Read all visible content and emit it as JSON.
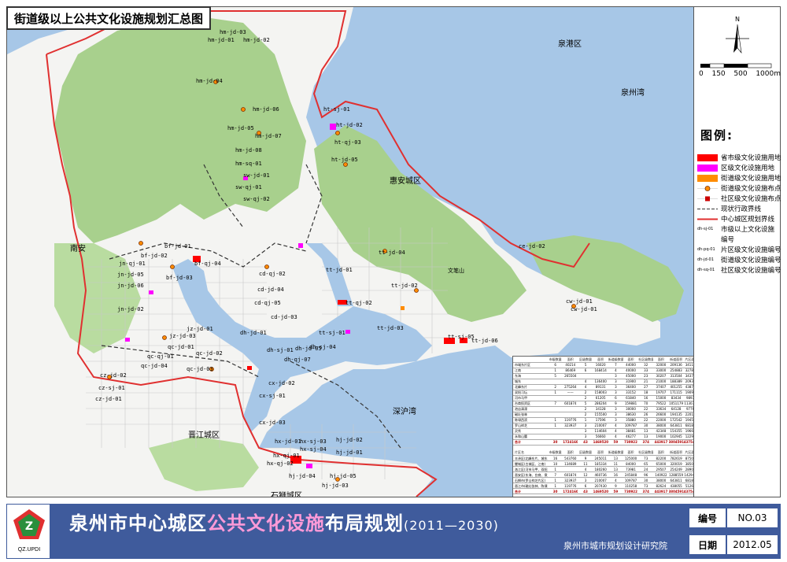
{
  "map_title": "街道级以上公共文化设施规划汇总图",
  "main_title_pre": "泉州市中心城区",
  "main_title_highlight": "公共文化设施",
  "main_title_post": "布局规划",
  "main_title_years": "(2011—2030)",
  "institute": "泉州市城市规划设计研究院",
  "logo_text": "QZ.UPDI",
  "info": {
    "number_label": "编号",
    "number_value": "NO.03",
    "date_label": "日期",
    "date_value": "2012.05"
  },
  "compass_letter": "N",
  "scale": {
    "labels": [
      "0",
      "150",
      "500",
      "1000m"
    ]
  },
  "legend": {
    "title": "图例:",
    "items": [
      {
        "label": "省市级文化设施用地",
        "color": "#ff0000",
        "kind": "fill"
      },
      {
        "label": "区级文化设施用地",
        "color": "#ff00ff",
        "kind": "fill"
      },
      {
        "label": "街道级文化设施用地",
        "color": "#ff8c00",
        "kind": "fill"
      },
      {
        "label": "街道级文化设施布点",
        "color": "#ff8c00",
        "kind": "point"
      },
      {
        "label": "社区级文化设施布点",
        "color": "#cc0000",
        "kind": "square"
      },
      {
        "label": "现状行政界线",
        "color": "#555555",
        "kind": "dash"
      },
      {
        "label": "中心城区规划界线",
        "color": "#e03030",
        "kind": "line"
      },
      {
        "label": "市级以上文化设施",
        "color": "#000000",
        "kind": "code",
        "code": "dh-sj-01"
      },
      {
        "label": "编号",
        "color": "#000000",
        "kind": "none"
      },
      {
        "label": "片区级文化设施编号",
        "color": "#000000",
        "kind": "code",
        "code": "dh-pq-01"
      },
      {
        "label": "街道级文化设施编号",
        "color": "#000000",
        "kind": "code",
        "code": "dh-jd-01"
      },
      {
        "label": "社区级文化设施编号",
        "color": "#000000",
        "kind": "code",
        "code": "dh-sq-01"
      }
    ]
  },
  "place_labels": [
    {
      "text": "泉港区"
    },
    {
      "text": "泉州湾"
    },
    {
      "text": "惠安城区"
    },
    {
      "text": "南安"
    },
    {
      "text": "晋江城区"
    },
    {
      "text": "石狮城区"
    },
    {
      "text": "深沪湾"
    },
    {
      "text": "文笔山"
    }
  ],
  "facility_codes": [
    "hm-jd-03",
    "hm-jd-01",
    "hm-jd-02",
    "hm-jd-04",
    "hm-jd-06",
    "hm-jd-05",
    "hm-jd-07",
    "hm-jd-08",
    "hm-sq-01",
    "sw-jd-01",
    "sw-qj-01",
    "sw-qj-02",
    "ht-sj-01",
    "ht-jd-02",
    "ht-qj-03",
    "ht-jd-05",
    "bf-jd-01",
    "bf-jd-02",
    "bf-qj-04",
    "bf-jd-03",
    "jn-qj-01",
    "jn-jd-05",
    "jn-jd-06",
    "jn-jd-02",
    "cd-qj-02",
    "cd-jd-04",
    "cd-qj-05",
    "cd-jd-03",
    "tt-jd-01",
    "tt-jd-04",
    "tt-jd-02",
    "tt-qj-02",
    "tt-sj-01",
    "tt-sj-05",
    "tt-jd-03",
    "tt-jd-06",
    "ce-jd-02",
    "cw-jd-01",
    "cw-jd-01",
    "dh-jd-01",
    "dh-sj-01",
    "dh-qj-07",
    "dh-jd-05",
    "dh-sj-04",
    "jz-jd-01",
    "jz-jd-03",
    "qc-jd-01",
    "qc-qj-01",
    "qc-jd-04",
    "qc-jd-02",
    "qc-jd-03",
    "cz-jd-02",
    "cz-sj-01",
    "cz-jd-01",
    "cx-jd-02",
    "cx-sj-01",
    "cx-jd-03",
    "hx-jd-01",
    "hx-sj-03",
    "hx-sj-04",
    "hx-qj-01",
    "hx-qj-02",
    "hj-jd-02",
    "hj-jd-04",
    "hj-jd-05",
    "hj-jd-03",
    "hj-jd-01"
  ],
  "table1": {
    "header": [
      "",
      "市级数量",
      "面积",
      "区级数量",
      "面积",
      "街道级数量",
      "面积",
      "社区级数量",
      "面积",
      "街道面积",
      "片区面积"
    ],
    "rows": [
      [
        "市域东片区",
        "6",
        "40214",
        "5",
        "16020",
        "7",
        "44000",
        "32",
        "32000",
        "209136",
        "341156"
      ],
      [
        "江南",
        "1",
        "86469",
        "6",
        "168414",
        "4",
        "40000",
        "33",
        "33000",
        "254883",
        "327803"
      ],
      [
        "东海",
        "5",
        "265504",
        "",
        "",
        "3",
        "45000",
        "23",
        "30207",
        "313504",
        "343791"
      ],
      [
        "城东",
        "",
        "",
        "4",
        "136400",
        "3",
        "31900",
        "21",
        "21000",
        "188389",
        "209389"
      ],
      [
        "北峰东片",
        "2",
        "275264",
        "4",
        "89131",
        "3",
        "36400",
        "27",
        "37407",
        "401255",
        "438742"
      ],
      [
        "双阳习坛",
        "1",
        "——",
        "2",
        "158003",
        "3",
        "33152",
        "18",
        "19707",
        "171115",
        "190902"
      ],
      [
        "河市马甲",
        "",
        "",
        "2",
        "61205",
        "6",
        "61840",
        "16",
        "15000",
        "83434",
        "98934"
      ],
      [
        "台商投资区",
        "7",
        "601874",
        "5",
        "286204",
        "9",
        "159881",
        "70",
        "79522",
        "1051179",
        "1130741"
      ],
      [
        "池店清濛",
        "",
        "",
        "2",
        "34128",
        "3",
        "30000",
        "22",
        "33634",
        "64128",
        "97762"
      ],
      [
        "磁灶张林",
        "",
        "",
        "2",
        "155500",
        "3",
        "38630",
        "26",
        "26600",
        "194135",
        "220135"
      ],
      [
        "陈埭西滨",
        "1",
        "119776",
        "1",
        "17596",
        "3",
        "35880",
        "22",
        "22000",
        "172542",
        "194542"
      ],
      [
        "罗山祥芝",
        "1",
        "323937",
        "3",
        "210007",
        "4",
        "109787",
        "30",
        "38000",
        "643811",
        "681811"
      ],
      [
        "灵秀",
        "",
        "",
        "3",
        "114604",
        "4",
        "38481",
        "13",
        "42348",
        "154355",
        "196695"
      ],
      [
        "永和山腰",
        "",
        "",
        "3",
        "56660",
        "4",
        "46277",
        "13",
        "19000",
        "102945",
        "122945"
      ],
      [
        "合计",
        "30",
        "1724160",
        "43",
        "1469520",
        "59",
        "730922",
        "374",
        "443917",
        "3804591",
        "4375400"
      ]
    ]
  },
  "table2": {
    "header": [
      "片区名",
      "市级数量",
      "面积",
      "区级数量",
      "面积",
      "街道级数量",
      "面积",
      "社区级数量",
      "面积",
      "街道面积",
      "片区面积"
    ],
    "rows": [
      [
        "丰泽区(北峰东片、城东、东海片区)",
        "16",
        "543760",
        "9",
        "245011",
        "13",
        "125000",
        "73",
        "82200",
        "782619",
        "875017"
      ],
      [
        "鲤城区(古城区、江南)",
        "10",
        "134689",
        "11",
        "185334",
        "11",
        "84000",
        "65",
        "65000",
        "320019",
        "385019"
      ],
      [
        "洛江区(河市马甲、双阳万安片区)",
        "1",
        "",
        "4",
        "180260",
        "13",
        "73981",
        "24",
        "29507",
        "254249",
        "289038"
      ],
      [
        "晋安区(东海、台商、泉港区)",
        "7",
        "601874",
        "12",
        "460736",
        "16",
        "245848",
        "96",
        "140922",
        "1288559",
        "1429481"
      ],
      [
        "石狮市(罗山祥芝片区)",
        "1",
        "323937",
        "3",
        "210007",
        "4",
        "109787",
        "30",
        "38000",
        "643811",
        "681811"
      ],
      [
        "晋江市(磁灶张林、陈埭西滨片区)",
        "1",
        "119776",
        "6",
        "207430",
        "9",
        "110258",
        "73",
        "82624",
        "438055",
        "512679"
      ],
      [
        "合计",
        "30",
        "1724160",
        "43",
        "1469520",
        "59",
        "730922",
        "374",
        "443917",
        "3804591",
        "4375400"
      ]
    ]
  }
}
